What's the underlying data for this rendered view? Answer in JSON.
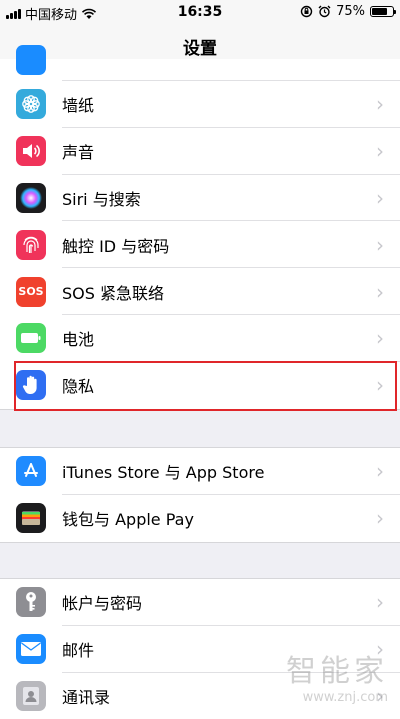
{
  "status_bar": {
    "carrier": "中国移动",
    "time": "16:35",
    "battery_percent": "75%",
    "battery_level": 0.75
  },
  "nav": {
    "title": "设置"
  },
  "groups": [
    {
      "items": [
        {
          "label": "墙纸",
          "icon": "wallpaper-icon",
          "color": "#34aadc"
        },
        {
          "label": "声音",
          "icon": "speaker-icon",
          "color": "#f0335a"
        },
        {
          "label": "Siri 与搜索",
          "icon": "siri-icon",
          "color": "#1c1c1e"
        },
        {
          "label": "触控 ID 与密码",
          "icon": "fingerprint-icon",
          "color": "#f0335a"
        },
        {
          "label": "SOS 紧急联络",
          "icon": "sos-icon",
          "color": "#f0412d",
          "icon_text": "SOS"
        },
        {
          "label": "电池",
          "icon": "battery-icon",
          "color": "#4cd964"
        },
        {
          "label": "隐私",
          "icon": "hand-icon",
          "color": "#2f6ef2"
        }
      ]
    },
    {
      "items": [
        {
          "label": "iTunes Store 与 App Store",
          "icon": "app-store-icon",
          "color": "#1f8bff"
        },
        {
          "label": "钱包与 Apple Pay",
          "icon": "wallet-icon",
          "color": "#1c1c1e"
        }
      ]
    },
    {
      "items": [
        {
          "label": "帐户与密码",
          "icon": "key-icon",
          "color": "#8e8e93"
        },
        {
          "label": "邮件",
          "icon": "mail-icon",
          "color": "#1a8cff"
        },
        {
          "label": "通讯录",
          "icon": "contacts-icon",
          "color": "#b8b8bd"
        }
      ]
    }
  ],
  "watermark": {
    "brand": "智能家",
    "url": "www.znj.com"
  }
}
